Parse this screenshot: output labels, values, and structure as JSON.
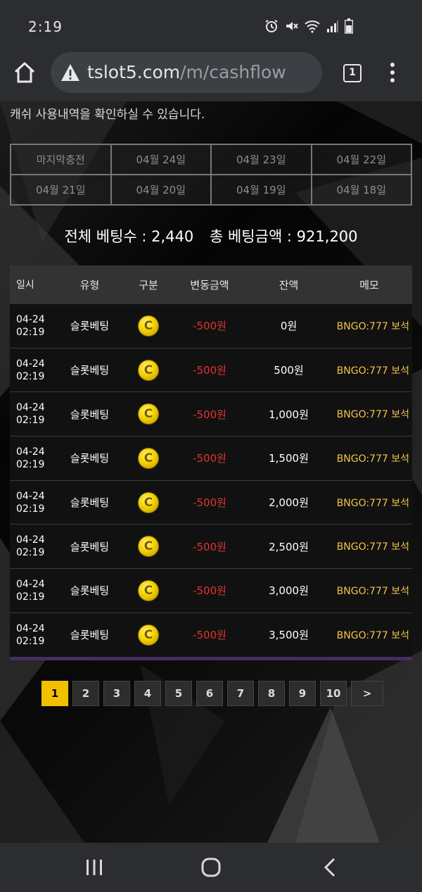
{
  "status": {
    "time": "2:19"
  },
  "browser": {
    "url_host": "tslot5.com",
    "url_path": "/m/cashflow",
    "tab_count": "1"
  },
  "page": {
    "intro": "캐쉬 사용내역을 확인하실 수 있습니다.",
    "date_filters": [
      "마지막충전",
      "04월 24일",
      "04월 23일",
      "04월 22일",
      "04월 21일",
      "04월 20일",
      "04월 19일",
      "04월 18일"
    ],
    "summary_count": "전체 베팅수 : 2,440",
    "summary_amount": "총 베팅금액 : 921,200",
    "table": {
      "headers": [
        "일시",
        "유형",
        "구분",
        "변동금액",
        "잔액",
        "메모"
      ],
      "coin_symbol": "C",
      "rows": [
        {
          "date": "04-24",
          "time": "02:19",
          "type": "슬롯베팅",
          "change": "-500원",
          "balance": "0원",
          "memo": "BNGO:777 보석"
        },
        {
          "date": "04-24",
          "time": "02:19",
          "type": "슬롯베팅",
          "change": "-500원",
          "balance": "500원",
          "memo": "BNGO:777 보석"
        },
        {
          "date": "04-24",
          "time": "02:19",
          "type": "슬롯베팅",
          "change": "-500원",
          "balance": "1,000원",
          "memo": "BNGO:777 보석"
        },
        {
          "date": "04-24",
          "time": "02:19",
          "type": "슬롯베팅",
          "change": "-500원",
          "balance": "1,500원",
          "memo": "BNGO:777 보석"
        },
        {
          "date": "04-24",
          "time": "02:19",
          "type": "슬롯베팅",
          "change": "-500원",
          "balance": "2,000원",
          "memo": "BNGO:777 보석"
        },
        {
          "date": "04-24",
          "time": "02:19",
          "type": "슬롯베팅",
          "change": "-500원",
          "balance": "2,500원",
          "memo": "BNGO:777 보석"
        },
        {
          "date": "04-24",
          "time": "02:19",
          "type": "슬롯베팅",
          "change": "-500원",
          "balance": "3,000원",
          "memo": "BNGO:777 보석"
        },
        {
          "date": "04-24",
          "time": "02:19",
          "type": "슬롯베팅",
          "change": "-500원",
          "balance": "3,500원",
          "memo": "BNGO:777 보석"
        }
      ]
    },
    "pagination": [
      "1",
      "2",
      "3",
      "4",
      "5",
      "6",
      "7",
      "8",
      "9",
      "10",
      ">"
    ]
  },
  "colors": {
    "accent_yellow": "#f3c000",
    "negative_red": "#e0342c",
    "memo_gold": "#f2c34b"
  },
  "icons": {
    "status": [
      "alarm-icon",
      "mute-icon",
      "wifi-icon",
      "signal-icon",
      "battery-icon"
    ],
    "nav": [
      "recent-apps-icon",
      "home-nav-icon",
      "back-icon"
    ]
  }
}
